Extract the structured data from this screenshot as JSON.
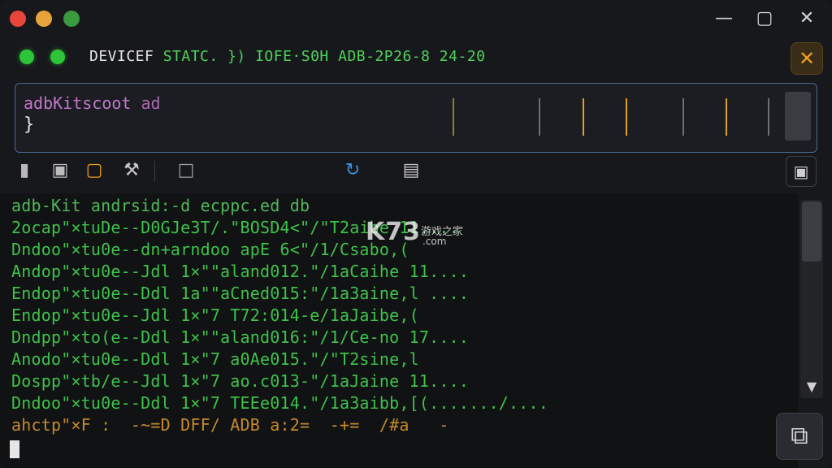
{
  "colors": {
    "traffic_red": "#e8453c",
    "traffic_yellow": "#e8a33a",
    "traffic_green": "#3a9a3f",
    "device_text": "#e6e6e6",
    "status_green": "#4fd25a",
    "terminal_green": "#3ec24a",
    "accent_orange": "#f0a020",
    "accent_blue": "#3f8fdb"
  },
  "status": {
    "device_label": "DEVICEF",
    "status_text": "STATC. }) IOFE·S0H ADB-2P26-8 24-20"
  },
  "command": {
    "text": "adbKitscoot",
    "suffix": "ad",
    "line2": "}"
  },
  "toolbar": {
    "icons": [
      "device-icon",
      "chip-icon",
      "phone-icon",
      "tools-icon",
      "screen-icon",
      "sync-icon",
      "screenshot-icon",
      "fullscreen-icon"
    ]
  },
  "terminal": {
    "header": "adb-Kit andrsid:-d ecppc.ed db",
    "lines": [
      "2ocap\"×tuDe--D0GJe3T/.\"BOSD4<\"/\"T2aibe 11....",
      "Dndoo\"×tu0e--dn+arndoo apE 6<\"/1/Csabo,(",
      "Andop\"×tu0e--Jdl 1×\"\"aland012.\"/1aCaihe 11....",
      "Endop\"×tu0e--Ddl 1a\"\"aCned015:\"/1a3aine,l ....",
      "Endop\"×tu0e--Jdl 1×\"7 T72:014-e/1aJaibe,(",
      "Dndpp\"×to(e--Ddl 1×\"\"aland016:\"/1/Ce-no 17....",
      "Anodo\"×tu0e--Ddl 1×\"7 a0Ae015.\"/\"T2sine,l",
      "Dospp\"×tb/e--Jdl 1×\"7 ao.c013-\"/1aJaine 11....",
      "Dndoo\"×tu0e--Ddl 1×\"7 TEEe014.\"/1a3aibb,[(......./...."
    ],
    "last": "ahctp\"×F :  -~=D DFF/ ADB a:2=  -+=  /#a   -"
  },
  "watermark": {
    "logo": "K73",
    "cn": "游戏之家",
    "com": ".com"
  }
}
